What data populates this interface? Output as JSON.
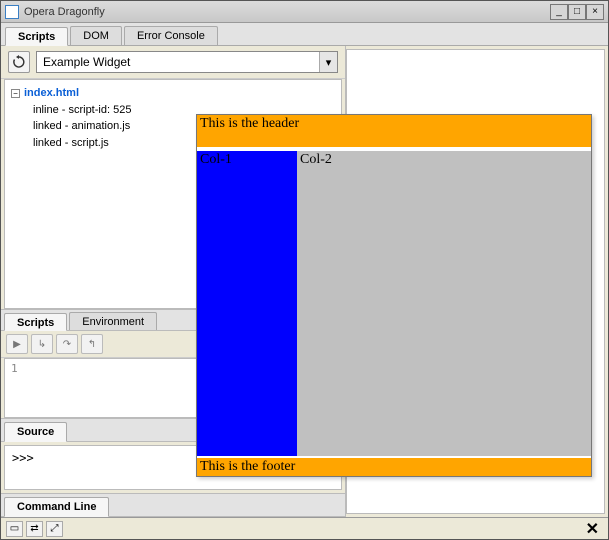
{
  "window": {
    "title": "Opera Dragonfly"
  },
  "main_tabs": [
    {
      "label": "Scripts",
      "active": true
    },
    {
      "label": "DOM",
      "active": false
    },
    {
      "label": "Error Console",
      "active": false
    }
  ],
  "selector": {
    "value": "Example Widget"
  },
  "tree": {
    "root_file": "index.html",
    "children": [
      "inline - script-id: 525",
      "linked - animation.js",
      "linked - script.js"
    ]
  },
  "sub_tabs": [
    {
      "label": "Scripts",
      "active": true
    },
    {
      "label": "Environment",
      "active": false
    }
  ],
  "source": {
    "label": "Source",
    "line1": "1"
  },
  "console": {
    "label": "Command Line",
    "prompt": ">>>"
  },
  "widget": {
    "header": "This is the header",
    "col1": "Col-1",
    "col2": "Col-2",
    "footer": "This is the footer"
  }
}
